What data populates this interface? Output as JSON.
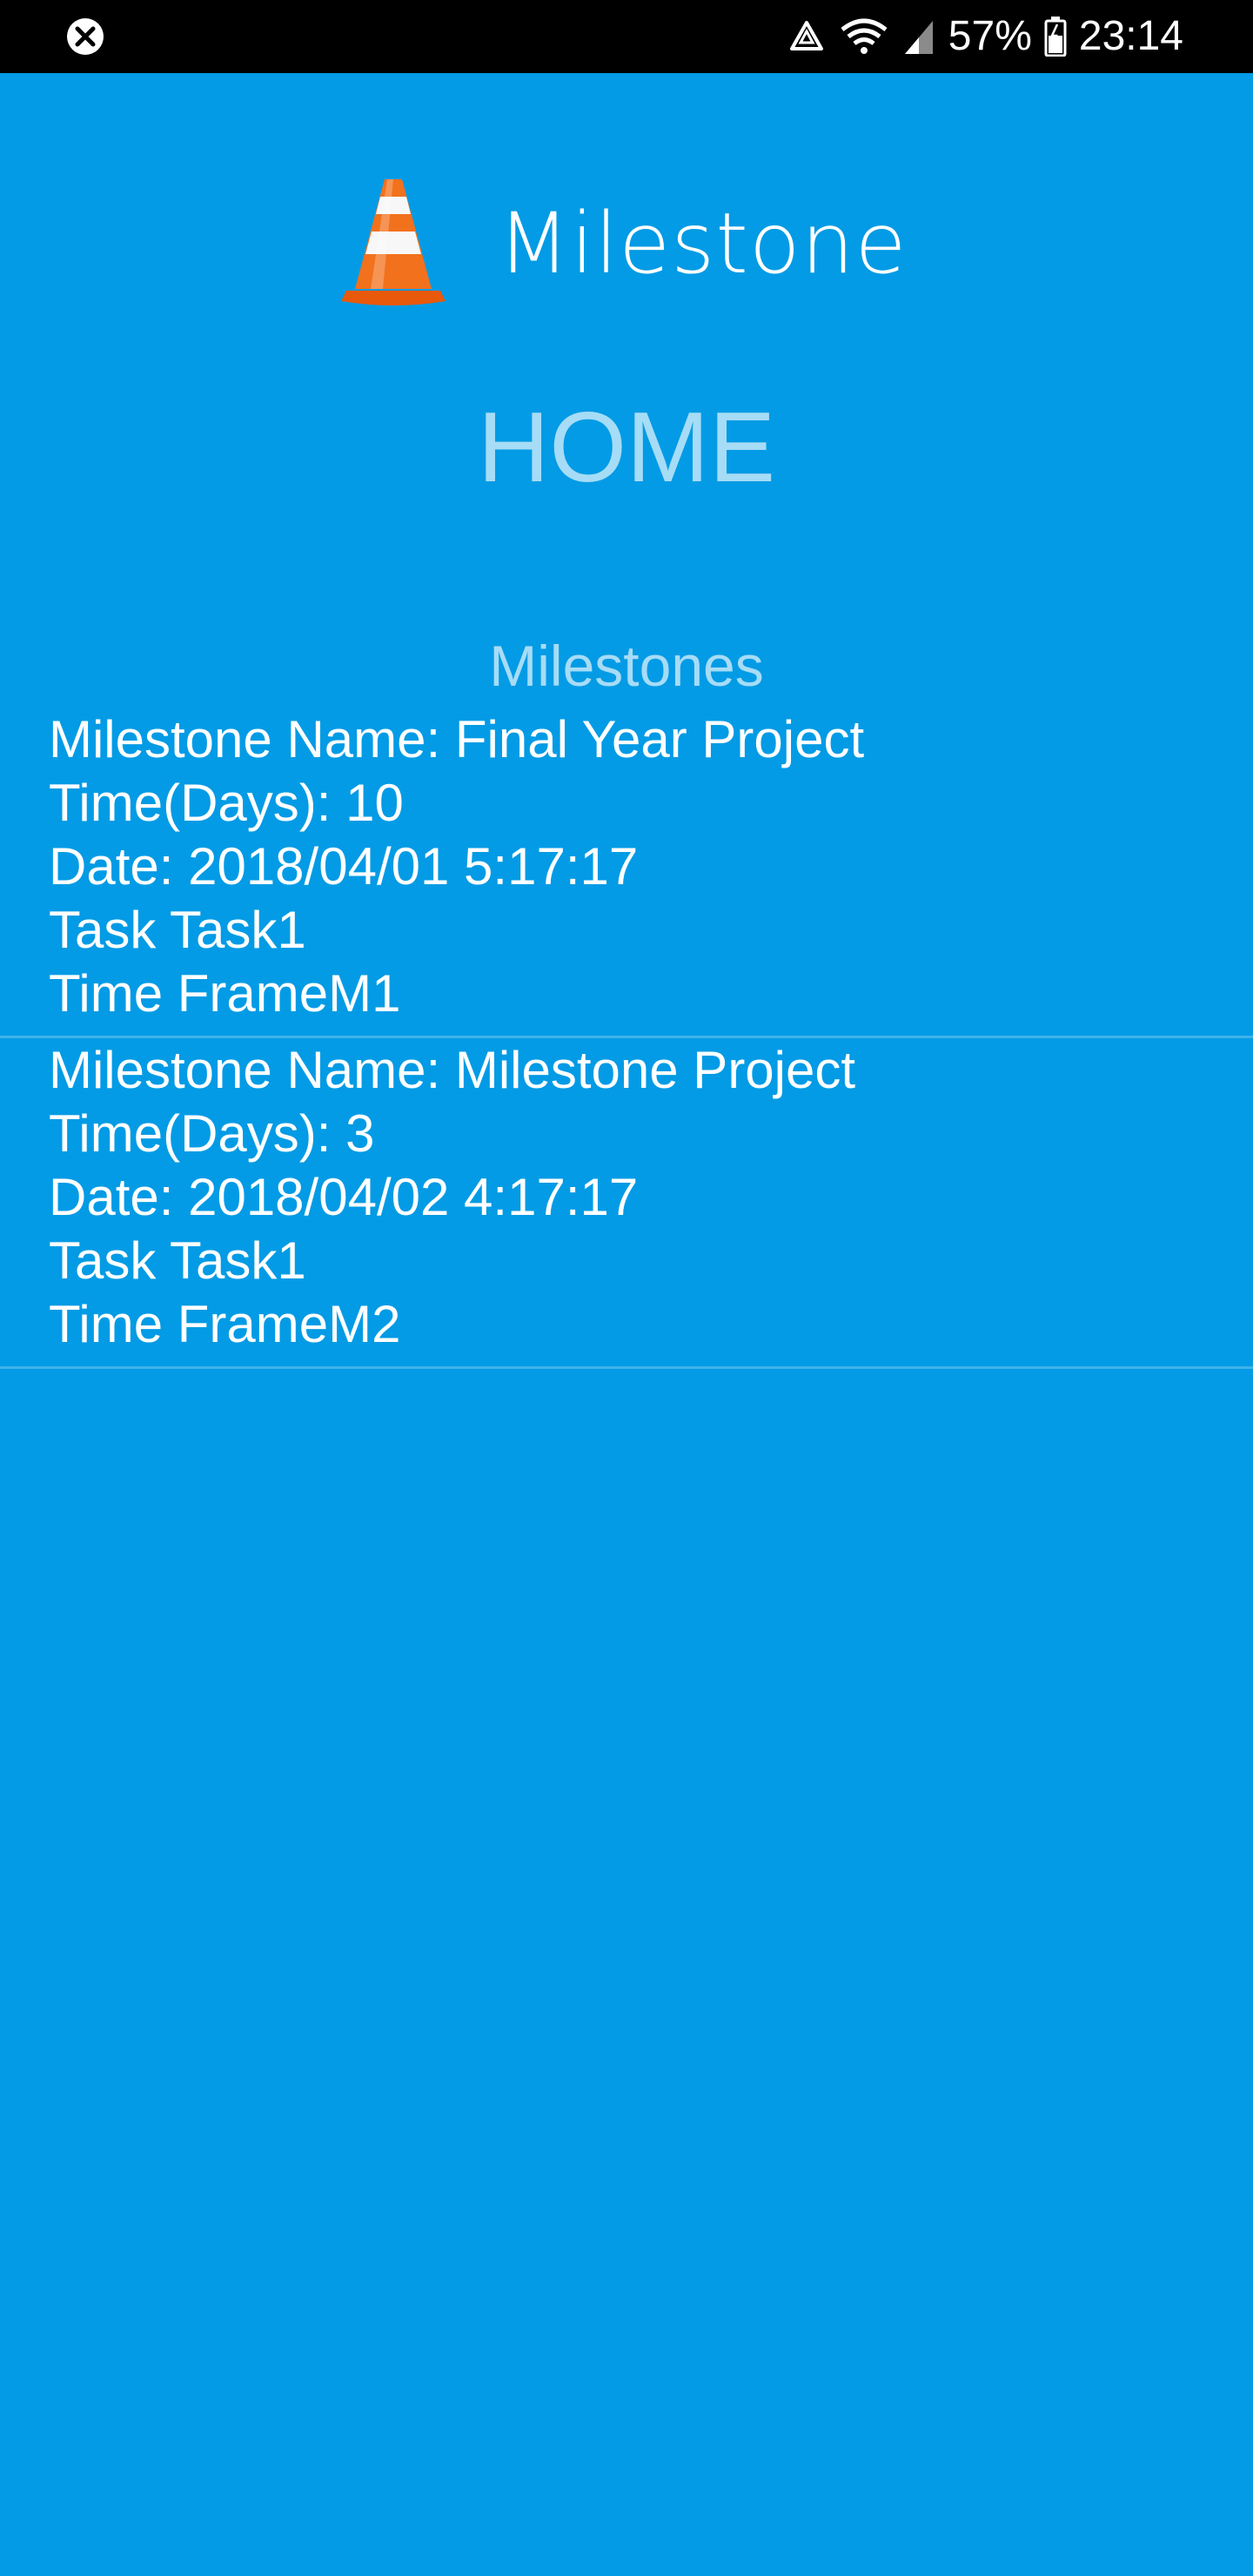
{
  "status_bar": {
    "battery": "57%",
    "time": "23:14",
    "icons": [
      "app-notification-icon",
      "recycle-icon",
      "wifi-icon",
      "signal-icon",
      "battery-icon"
    ]
  },
  "header": {
    "app_name": "Milestone",
    "page_title": "HOME"
  },
  "section": {
    "title": "Milestones"
  },
  "milestones": [
    {
      "name": "Milestone Name: Final Year Project",
      "time_days": "Time(Days): 10",
      "date": "Date: 2018/04/01 5:17:17",
      "task": "Task Task1",
      "time_frame": "Time FrameM1"
    },
    {
      "name": "Milestone Name: Milestone Project",
      "time_days": "Time(Days): 3",
      "date": "Date: 2018/04/02 4:17:17",
      "task": "Task Task1",
      "time_frame": "Time FrameM2"
    }
  ],
  "colors": {
    "background": "#039be5",
    "title": "#a6dcf6",
    "divider": "#3fb3ea",
    "status_bar": "#000000"
  }
}
